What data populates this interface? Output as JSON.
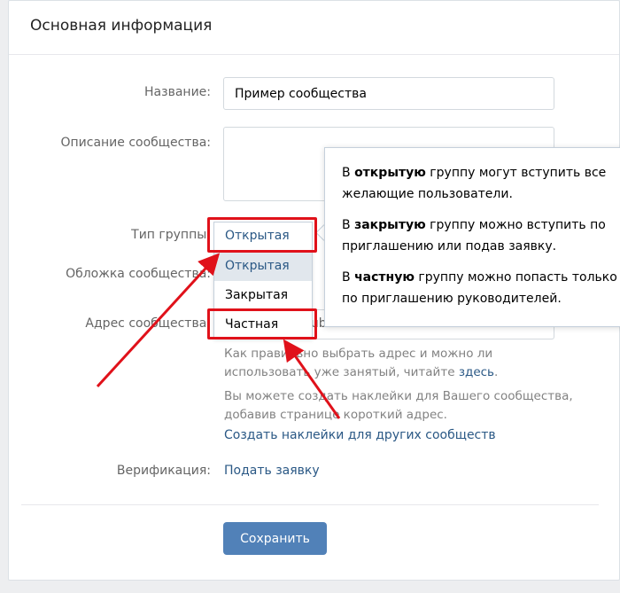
{
  "header": {
    "title": "Основная информация"
  },
  "form": {
    "name_label": "Название:",
    "name_value": "Пример сообщества",
    "description_label": "Описание сообщества:",
    "description_value": "",
    "group_type_label": "Тип группы:",
    "group_type_selected": "Открытая",
    "group_type_options": [
      "Открытая",
      "Закрытая",
      "Частная"
    ],
    "cover_label": "Обложка сообщества:",
    "address_label": "Адрес сообщества:",
    "address_value": "public",
    "address_hint_text": "Как правильно выбрать адрес и можно ли использовать уже занятый, читайте",
    "address_hint_link": "здесь",
    "sticker_hint": "Вы можете создать наклейки для Вашего сообщества, добавив странице короткий адрес.",
    "sticker_link": "Создать наклейки для других сообществ",
    "verification_label": "Верификация:",
    "verification_link": "Подать заявку",
    "save_label": "Сохранить"
  },
  "tooltip": {
    "open": {
      "pre": "В ",
      "bold": "открытую",
      "post": " группу могут вступить все желающие пользователи."
    },
    "closed": {
      "pre": "В ",
      "bold": "закрытую",
      "post": " группу можно вступить по приглашению или подав заявку."
    },
    "private": {
      "pre": "В ",
      "bold": "частную",
      "post": " группу можно попасть только по приглашению руководителей."
    }
  },
  "colors": {
    "accent": "#5181b8",
    "link": "#2a5885",
    "highlight": "#e0111a"
  }
}
